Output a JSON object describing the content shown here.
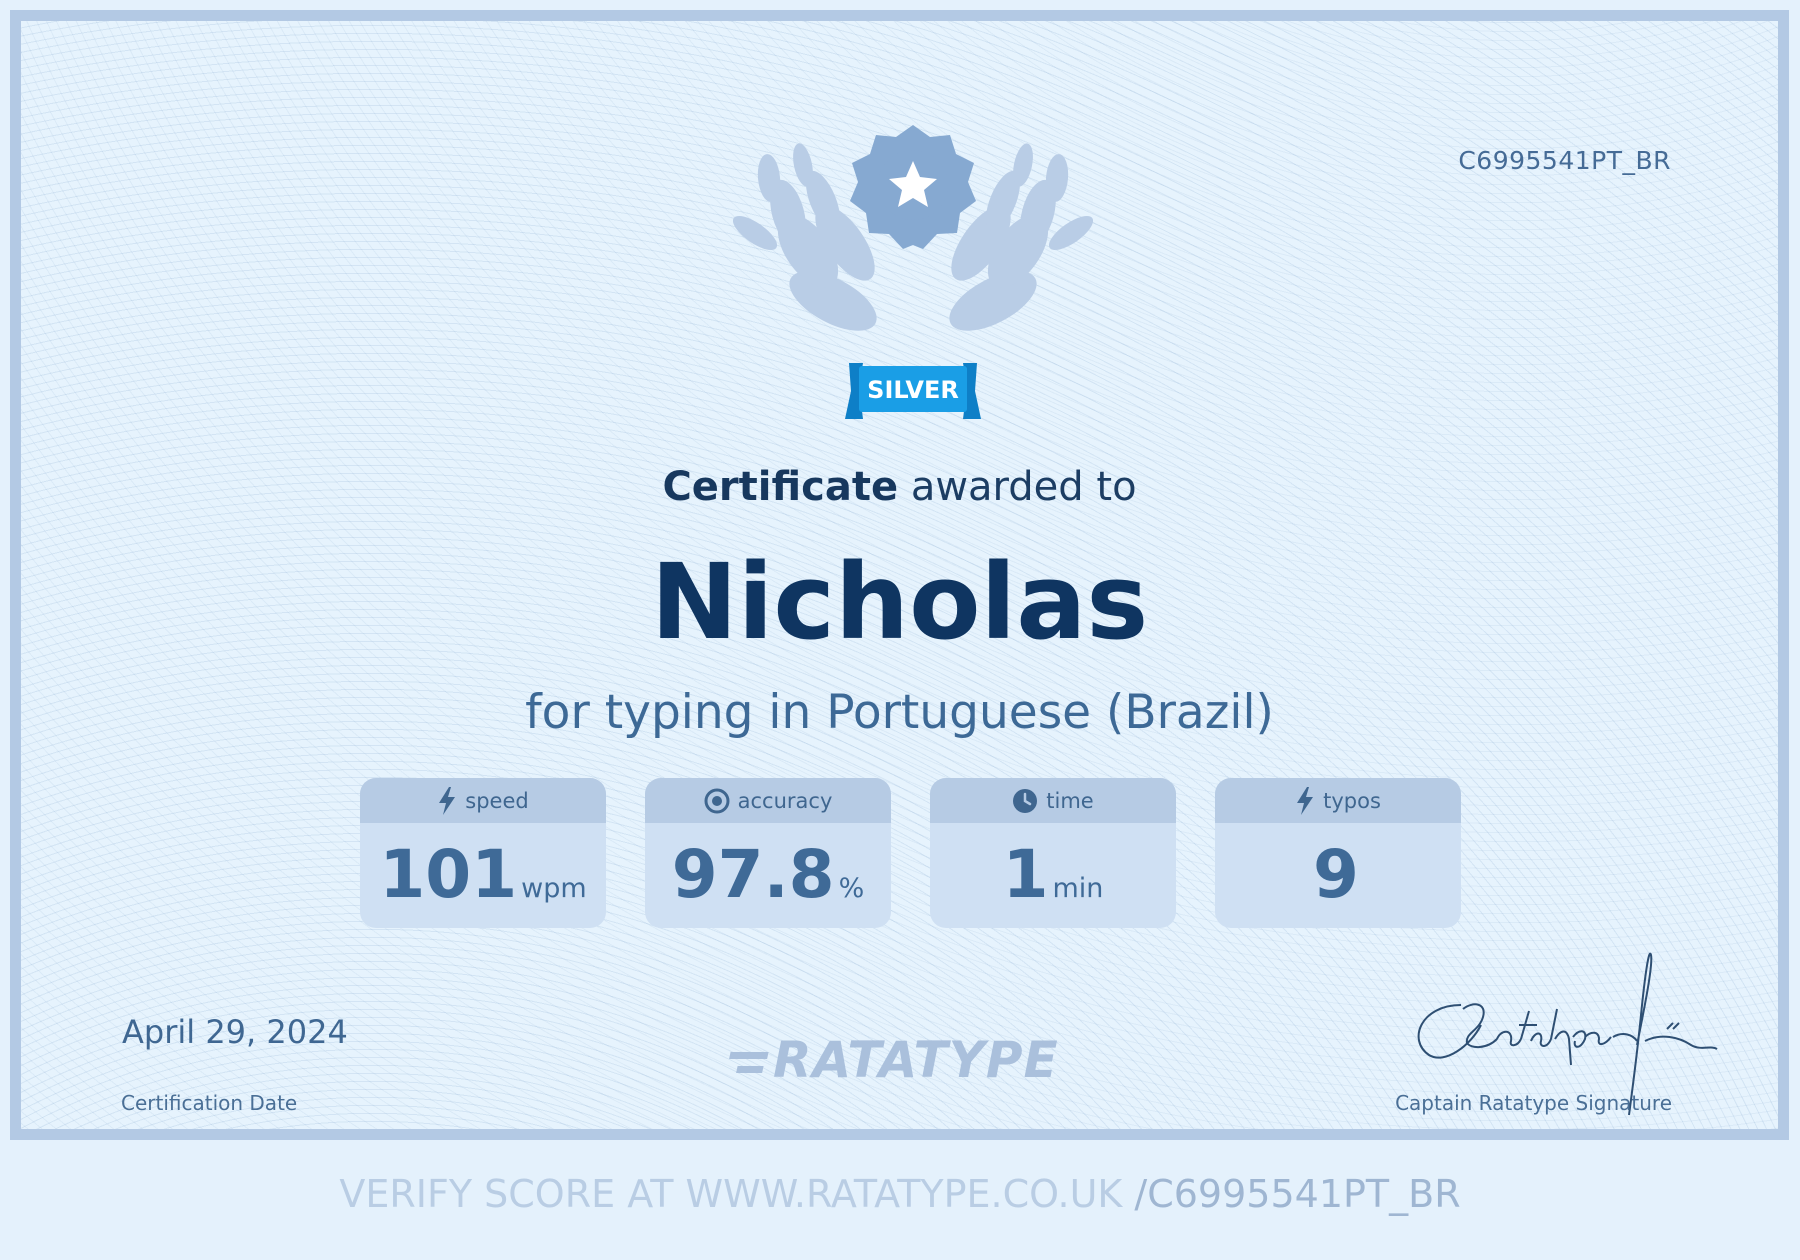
{
  "certificate": {
    "id": "C6995541PT_BR",
    "badge_label": "SILVER",
    "heading_bold": "Certificate",
    "heading_rest": "awarded to",
    "recipient": "Nicholas",
    "subject": "for typing in Portuguese (Brazil)"
  },
  "stats": [
    {
      "label": "speed",
      "icon": "lightning-icon",
      "value": "101",
      "unit": "wpm"
    },
    {
      "label": "accuracy",
      "icon": "target-icon",
      "value": "97.8",
      "unit": "%"
    },
    {
      "label": "time",
      "icon": "clock-icon",
      "value": "1",
      "unit": "min"
    },
    {
      "label": "typos",
      "icon": "lightning-icon",
      "value": "9",
      "unit": ""
    }
  ],
  "footer": {
    "date": "April 29, 2024",
    "date_label": "Certification Date",
    "logo_text": "RATATYPE",
    "signature_label": "Captain Ratatype Signature"
  },
  "verify": {
    "prefix": "VERIFY SCORE AT WWW.RATATYPE.CO.UK ",
    "id_part": "/C6995541PT_BR"
  },
  "colors": {
    "border": "#b3c9e4",
    "background": "#e6f3fd",
    "navy": "#0f3561",
    "badge_blue": "#1a9ee6",
    "medal": "#86a9d1",
    "laurel": "#b9cde6"
  }
}
